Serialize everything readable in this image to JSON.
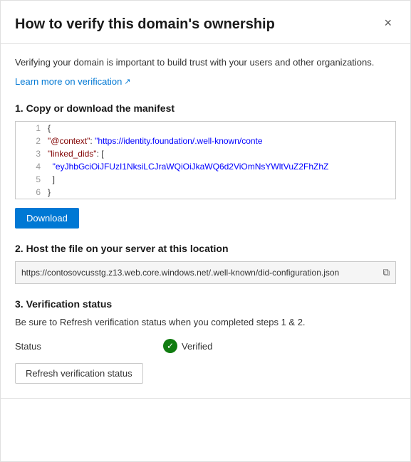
{
  "panel": {
    "title": "How to verify this domain's ownership",
    "close_label": "×"
  },
  "intro": {
    "text": "Verifying your domain is important to build trust with your users and other organizations.",
    "learn_more_label": "Learn more on verification",
    "learn_more_external_icon": "↗"
  },
  "step1": {
    "title": "1. Copy or download the manifest",
    "code_lines": [
      {
        "num": "1",
        "content": "{"
      },
      {
        "num": "2",
        "content": "  \"@context\": \"https://identity.foundation/.well-known/conte"
      },
      {
        "num": "3",
        "content": "  \"linked_dids\": ["
      },
      {
        "num": "4",
        "content": "    \"eyJhbGciOiJFUzI1NksiLCJraWQiOiJkaWQ6d2ViOmNsYWltVuZ2FhZhZ"
      },
      {
        "num": "5",
        "content": "  ]"
      },
      {
        "num": "6",
        "content": "}"
      }
    ],
    "download_label": "Download"
  },
  "step2": {
    "title": "2. Host the file on your server at this location",
    "url": "https://contosovcusstg.z13.web.core.windows.net/.well-known/did-configuration.json",
    "copy_icon": "⧉"
  },
  "step3": {
    "title": "3. Verification status",
    "note": "Be sure to Refresh verification status when you completed steps 1 & 2.",
    "status_label": "Status",
    "verified_text": "Verified",
    "refresh_label": "Refresh verification status",
    "verified_checkmark": "✓"
  }
}
